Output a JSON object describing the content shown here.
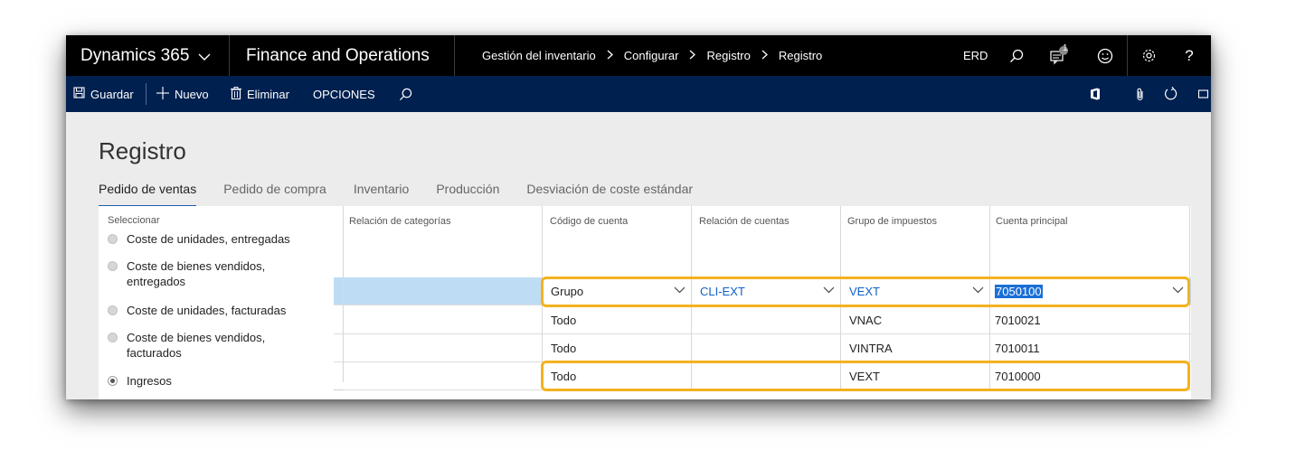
{
  "topbar": {
    "brand": "Dynamics 365",
    "product": "Finance and Operations",
    "breadcrumb": [
      "Gestión del inventario",
      "Configurar",
      "Registro",
      "Registro"
    ],
    "company": "ERD",
    "notification_count": "1"
  },
  "actions": {
    "save": "Guardar",
    "new": "Nuevo",
    "delete": "Eliminar",
    "options": "OPCIONES"
  },
  "page": {
    "title": "Registro",
    "tabs": [
      "Pedido de ventas",
      "Pedido de compra",
      "Inventario",
      "Producción",
      "Desviación de coste estándar"
    ],
    "active_tab": 0
  },
  "select_panel": {
    "label": "Seleccionar",
    "options": [
      "Coste de unidades, entregadas",
      "Coste de bienes vendidos, entregados",
      "Coste de unidades, facturadas",
      "Coste de bienes vendidos, facturados",
      "Ingresos"
    ],
    "selected_index": 4
  },
  "grid": {
    "columns": [
      "Relación de categorías",
      "Código de cuenta",
      "Relación de cuentas",
      "Grupo de impuestos",
      "Cuenta principal"
    ],
    "rows": [
      [
        "",
        "Grupo",
        "CLI-EXT",
        "VEXT",
        "7050100"
      ],
      [
        "",
        "Todo",
        "",
        "VNAC",
        "7010021"
      ],
      [
        "",
        "Todo",
        "",
        "VINTRA",
        "7010011"
      ],
      [
        "",
        "Todo",
        "",
        "VEXT",
        "7010000"
      ]
    ],
    "selected_row": 0
  },
  "colors": {
    "topbar": "#000000",
    "actionbar": "#002050",
    "selected_row": "#bfdcf5",
    "highlight_outline": "#f5b21e",
    "link": "#1060c8"
  }
}
